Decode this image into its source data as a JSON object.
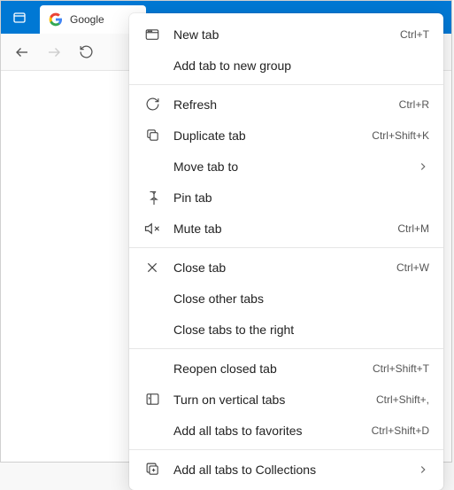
{
  "tab": {
    "title": "Google"
  },
  "menu": {
    "new_tab": {
      "label": "New tab",
      "shortcut": "Ctrl+T"
    },
    "add_to_group": {
      "label": "Add tab to new group"
    },
    "refresh": {
      "label": "Refresh",
      "shortcut": "Ctrl+R"
    },
    "duplicate": {
      "label": "Duplicate tab",
      "shortcut": "Ctrl+Shift+K"
    },
    "move_to": {
      "label": "Move tab to"
    },
    "pin": {
      "label": "Pin tab"
    },
    "mute": {
      "label": "Mute tab",
      "shortcut": "Ctrl+M"
    },
    "close": {
      "label": "Close tab",
      "shortcut": "Ctrl+W"
    },
    "close_other": {
      "label": "Close other tabs"
    },
    "close_right": {
      "label": "Close tabs to the right"
    },
    "reopen": {
      "label": "Reopen closed tab",
      "shortcut": "Ctrl+Shift+T"
    },
    "vertical_tabs": {
      "label": "Turn on vertical tabs",
      "shortcut": "Ctrl+Shift+,"
    },
    "favorites_all": {
      "label": "Add all tabs to favorites",
      "shortcut": "Ctrl+Shift+D"
    },
    "collections_all": {
      "label": "Add all tabs to Collections"
    }
  }
}
